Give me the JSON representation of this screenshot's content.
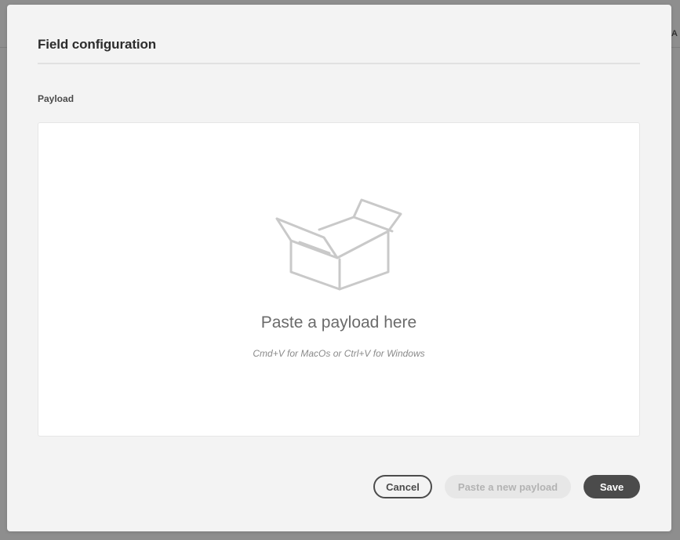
{
  "background": {
    "edge_text": "A"
  },
  "dialog": {
    "title": "Field configuration",
    "field_label": "Payload",
    "drop_zone": {
      "icon": "open-box-icon",
      "heading": "Paste a payload here",
      "hint": "Cmd+V for MacOs or Ctrl+V for Windows"
    },
    "buttons": {
      "cancel": "Cancel",
      "paste_new": "Paste a new payload",
      "save": "Save"
    }
  },
  "colors": {
    "dialog_bg": "#f3f3f3",
    "overlay": "#8e8e8e",
    "primary_button": "#4b4b4b",
    "disabled_button_bg": "#e7e7e7",
    "disabled_button_text": "#b3b3b3"
  }
}
